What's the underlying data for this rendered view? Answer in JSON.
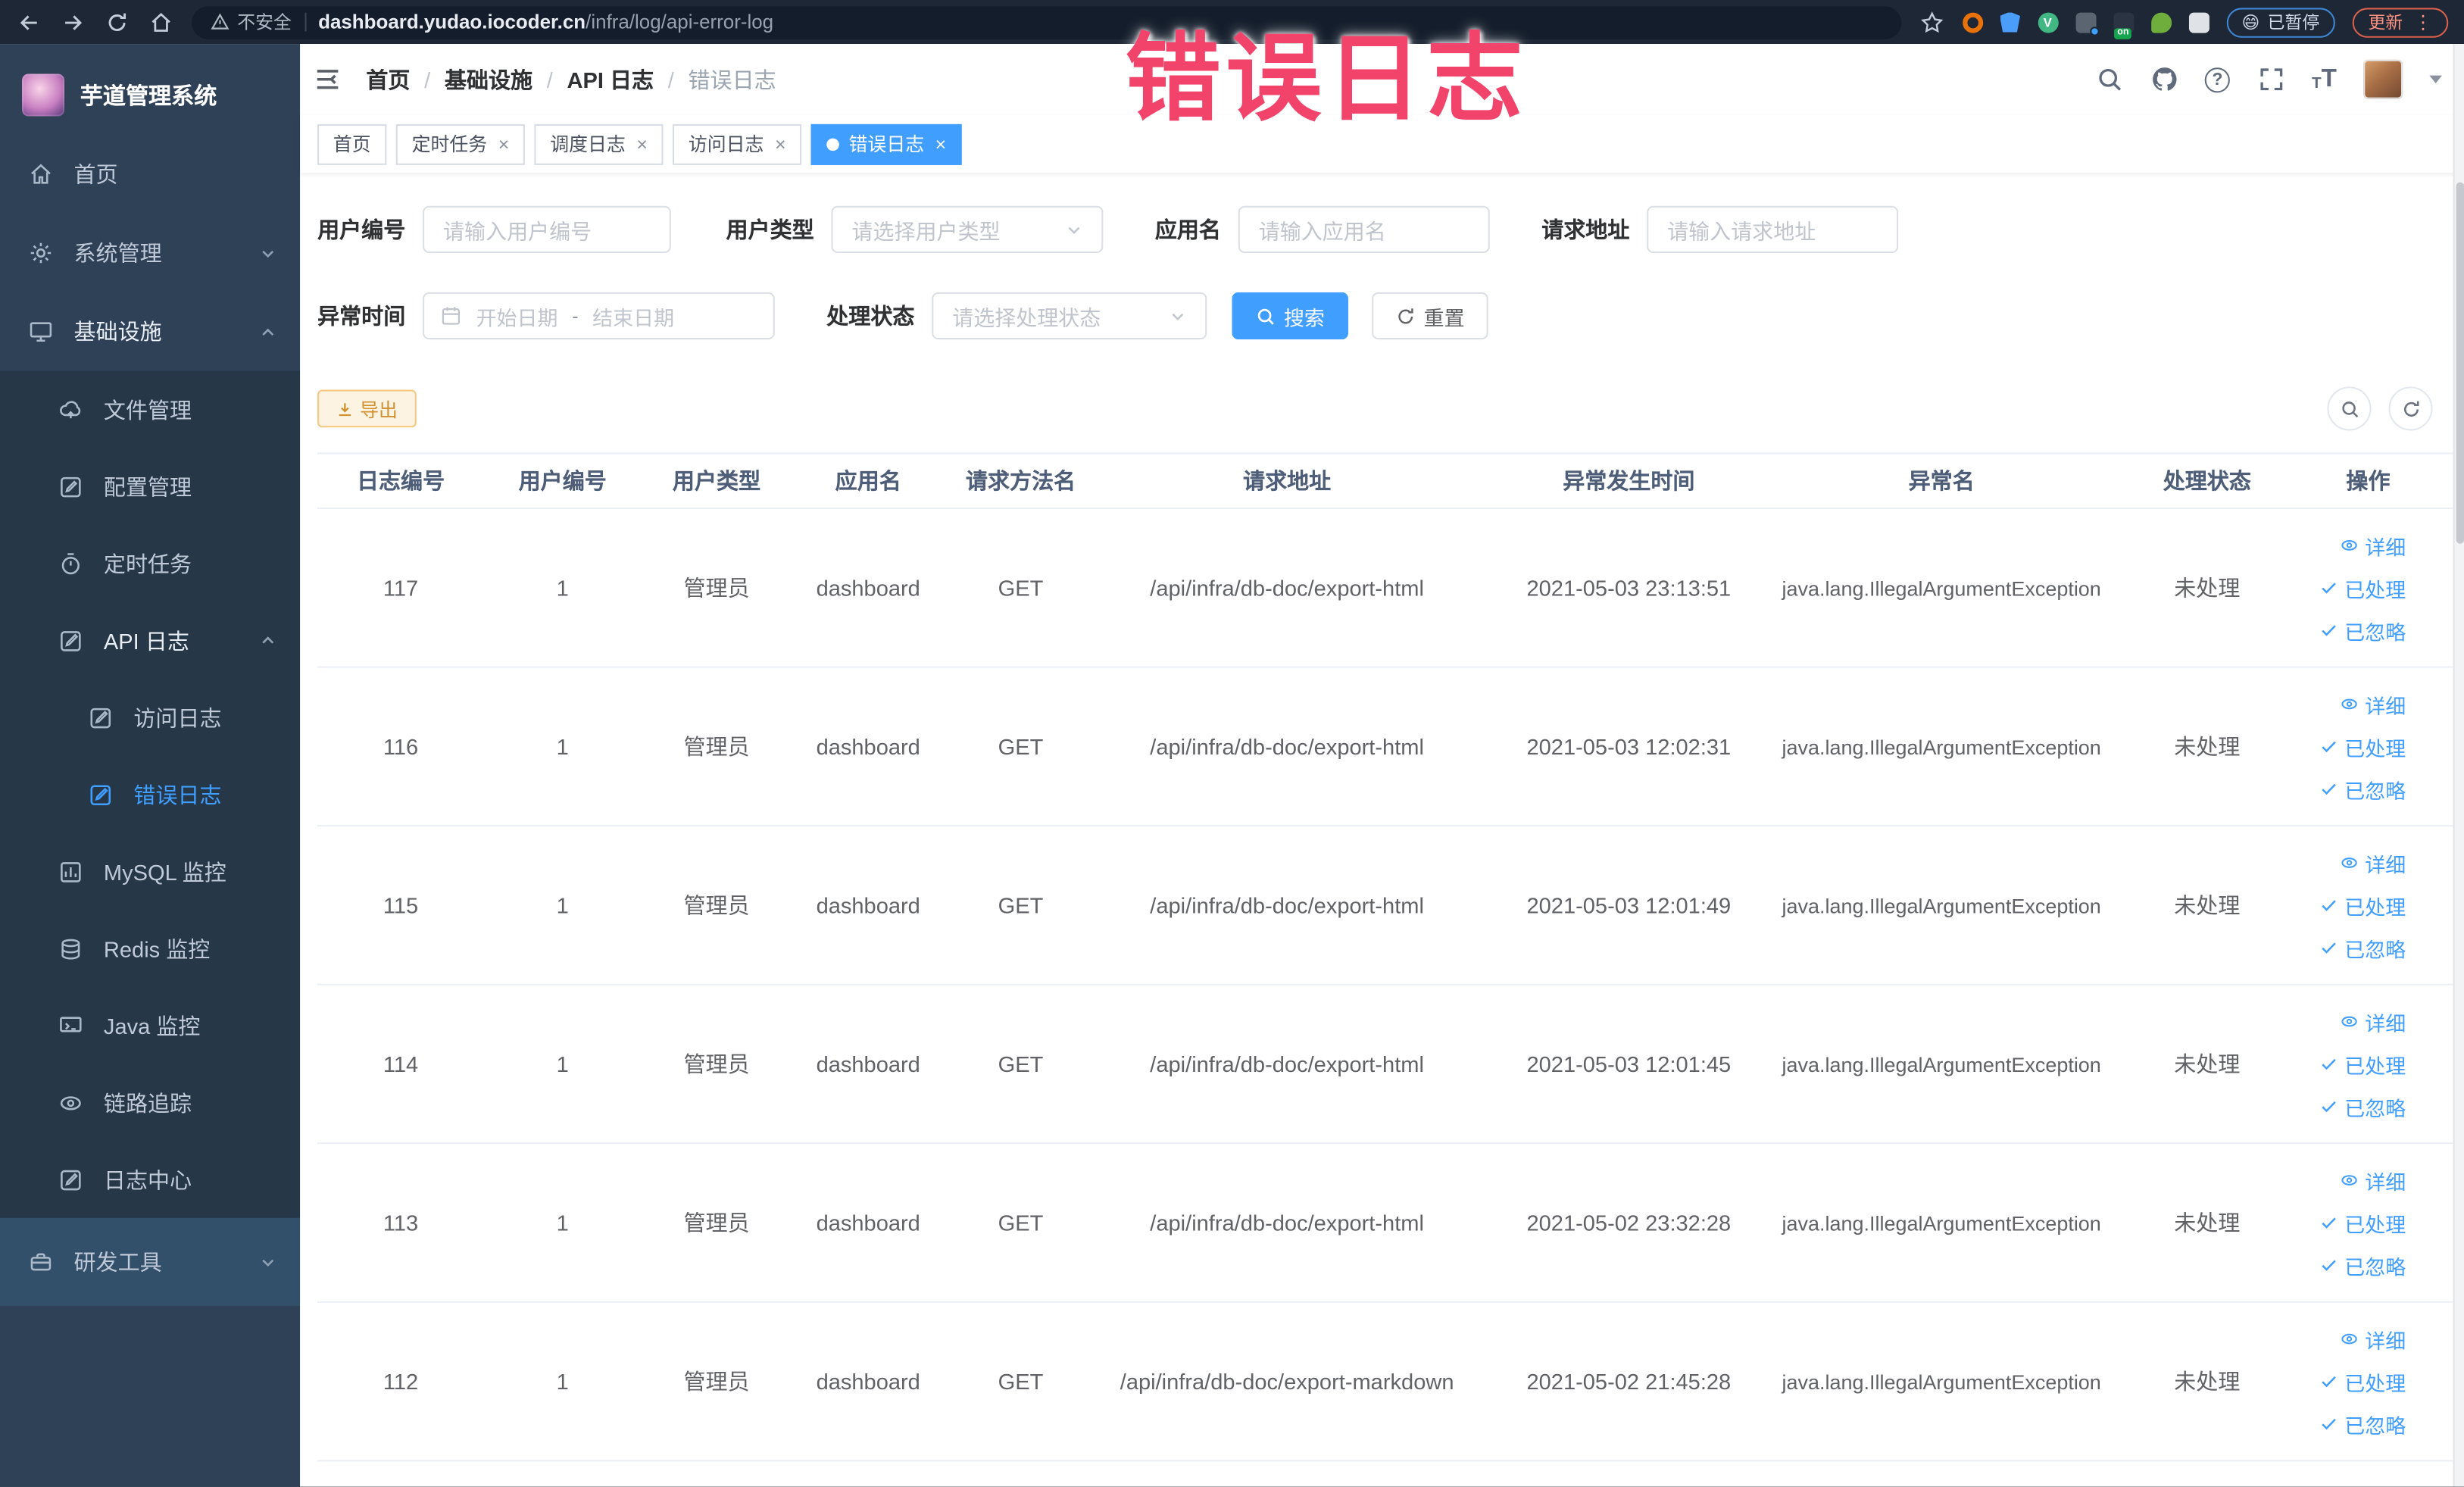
{
  "browser": {
    "security_label": "不安全",
    "url_domain": "dashboard.yudao.iocoder.cn",
    "url_path": "/infra/log/api-error-log",
    "extensions": {
      "vue_letter": "V",
      "switch_badge": "on"
    },
    "paused_badge": {
      "emoji": "😄",
      "label": "已暂停"
    },
    "update_label": "更新",
    "kebab_glyph": "⋮"
  },
  "overlay_text": "错误日志",
  "sidebar": {
    "app_title": "芋道管理系统",
    "items": [
      {
        "label": "首页"
      },
      {
        "label": "系统管理"
      },
      {
        "label": "基础设施"
      },
      {
        "label": "文件管理"
      },
      {
        "label": "配置管理"
      },
      {
        "label": "定时任务"
      },
      {
        "label": "API 日志"
      },
      {
        "label": "访问日志"
      },
      {
        "label": "错误日志"
      },
      {
        "label": "MySQL 监控"
      },
      {
        "label": "Redis 监控"
      },
      {
        "label": "Java 监控"
      },
      {
        "label": "链路追踪"
      },
      {
        "label": "日志中心"
      },
      {
        "label": "研发工具"
      }
    ]
  },
  "header": {
    "breadcrumb": [
      "首页",
      "基础设施",
      "API 日志",
      "错误日志"
    ],
    "breadcrumb_sep": "/",
    "help_glyph": "?",
    "font_icon_small": "T",
    "font_icon_large": "T"
  },
  "tabs": [
    {
      "label": "首页"
    },
    {
      "label": "定时任务"
    },
    {
      "label": "调度日志"
    },
    {
      "label": "访问日志"
    },
    {
      "label": "错误日志"
    }
  ],
  "ui": {
    "close_glyph": "×"
  },
  "filters": {
    "user_id": {
      "label": "用户编号",
      "placeholder": "请输入用户编号"
    },
    "user_type": {
      "label": "用户类型",
      "placeholder": "请选择用户类型"
    },
    "app_name": {
      "label": "应用名",
      "placeholder": "请输入应用名"
    },
    "request_url": {
      "label": "请求地址",
      "placeholder": "请输入请求地址"
    },
    "exception_time": {
      "label": "异常时间",
      "start_placeholder": "开始日期",
      "separator": "-",
      "end_placeholder": "结束日期"
    },
    "process_status": {
      "label": "处理状态",
      "placeholder": "请选择处理状态"
    },
    "search_label": "搜索",
    "reset_label": "重置"
  },
  "toolbar": {
    "export_label": "导出"
  },
  "table": {
    "columns": [
      "日志编号",
      "用户编号",
      "用户类型",
      "应用名",
      "请求方法名",
      "请求地址",
      "异常发生时间",
      "异常名",
      "处理状态",
      "操作"
    ],
    "actions": {
      "detail": "详细",
      "processed": "已处理",
      "ignored": "已忽略"
    },
    "rows": [
      {
        "id": "117",
        "user_id": "1",
        "user_type": "管理员",
        "app": "dashboard",
        "method": "GET",
        "url": "/api/infra/db-doc/export-html",
        "time": "2021-05-03 23:13:51",
        "exception": "java.lang.IllegalArgumentException",
        "status": "未处理"
      },
      {
        "id": "116",
        "user_id": "1",
        "user_type": "管理员",
        "app": "dashboard",
        "method": "GET",
        "url": "/api/infra/db-doc/export-html",
        "time": "2021-05-03 12:02:31",
        "exception": "java.lang.IllegalArgumentException",
        "status": "未处理"
      },
      {
        "id": "115",
        "user_id": "1",
        "user_type": "管理员",
        "app": "dashboard",
        "method": "GET",
        "url": "/api/infra/db-doc/export-html",
        "time": "2021-05-03 12:01:49",
        "exception": "java.lang.IllegalArgumentException",
        "status": "未处理"
      },
      {
        "id": "114",
        "user_id": "1",
        "user_type": "管理员",
        "app": "dashboard",
        "method": "GET",
        "url": "/api/infra/db-doc/export-html",
        "time": "2021-05-03 12:01:45",
        "exception": "java.lang.IllegalArgumentException",
        "status": "未处理"
      },
      {
        "id": "113",
        "user_id": "1",
        "user_type": "管理员",
        "app": "dashboard",
        "method": "GET",
        "url": "/api/infra/db-doc/export-html",
        "time": "2021-05-02 23:32:28",
        "exception": "java.lang.IllegalArgumentException",
        "status": "未处理"
      },
      {
        "id": "112",
        "user_id": "1",
        "user_type": "管理员",
        "app": "dashboard",
        "method": "GET",
        "url": "/api/infra/db-doc/export-markdown",
        "time": "2021-05-02 21:45:28",
        "exception": "java.lang.IllegalArgumentException",
        "status": "未处理"
      }
    ]
  },
  "colors": {
    "accent": "#409eff",
    "overlay_pink": "#f2436b",
    "warning": "#e6a23c",
    "sidebar_bg": "#2e4156",
    "submenu_bg": "#263848"
  }
}
